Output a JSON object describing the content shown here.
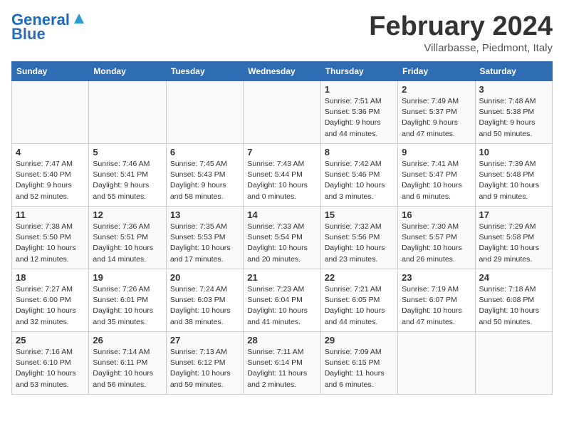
{
  "header": {
    "logo_line1": "General",
    "logo_line2": "Blue",
    "month": "February 2024",
    "location": "Villarbasse, Piedmont, Italy"
  },
  "days_of_week": [
    "Sunday",
    "Monday",
    "Tuesday",
    "Wednesday",
    "Thursday",
    "Friday",
    "Saturday"
  ],
  "weeks": [
    [
      {
        "day": "",
        "info": ""
      },
      {
        "day": "",
        "info": ""
      },
      {
        "day": "",
        "info": ""
      },
      {
        "day": "",
        "info": ""
      },
      {
        "day": "1",
        "info": "Sunrise: 7:51 AM\nSunset: 5:36 PM\nDaylight: 9 hours\nand 44 minutes."
      },
      {
        "day": "2",
        "info": "Sunrise: 7:49 AM\nSunset: 5:37 PM\nDaylight: 9 hours\nand 47 minutes."
      },
      {
        "day": "3",
        "info": "Sunrise: 7:48 AM\nSunset: 5:38 PM\nDaylight: 9 hours\nand 50 minutes."
      }
    ],
    [
      {
        "day": "4",
        "info": "Sunrise: 7:47 AM\nSunset: 5:40 PM\nDaylight: 9 hours\nand 52 minutes."
      },
      {
        "day": "5",
        "info": "Sunrise: 7:46 AM\nSunset: 5:41 PM\nDaylight: 9 hours\nand 55 minutes."
      },
      {
        "day": "6",
        "info": "Sunrise: 7:45 AM\nSunset: 5:43 PM\nDaylight: 9 hours\nand 58 minutes."
      },
      {
        "day": "7",
        "info": "Sunrise: 7:43 AM\nSunset: 5:44 PM\nDaylight: 10 hours\nand 0 minutes."
      },
      {
        "day": "8",
        "info": "Sunrise: 7:42 AM\nSunset: 5:46 PM\nDaylight: 10 hours\nand 3 minutes."
      },
      {
        "day": "9",
        "info": "Sunrise: 7:41 AM\nSunset: 5:47 PM\nDaylight: 10 hours\nand 6 minutes."
      },
      {
        "day": "10",
        "info": "Sunrise: 7:39 AM\nSunset: 5:48 PM\nDaylight: 10 hours\nand 9 minutes."
      }
    ],
    [
      {
        "day": "11",
        "info": "Sunrise: 7:38 AM\nSunset: 5:50 PM\nDaylight: 10 hours\nand 12 minutes."
      },
      {
        "day": "12",
        "info": "Sunrise: 7:36 AM\nSunset: 5:51 PM\nDaylight: 10 hours\nand 14 minutes."
      },
      {
        "day": "13",
        "info": "Sunrise: 7:35 AM\nSunset: 5:53 PM\nDaylight: 10 hours\nand 17 minutes."
      },
      {
        "day": "14",
        "info": "Sunrise: 7:33 AM\nSunset: 5:54 PM\nDaylight: 10 hours\nand 20 minutes."
      },
      {
        "day": "15",
        "info": "Sunrise: 7:32 AM\nSunset: 5:56 PM\nDaylight: 10 hours\nand 23 minutes."
      },
      {
        "day": "16",
        "info": "Sunrise: 7:30 AM\nSunset: 5:57 PM\nDaylight: 10 hours\nand 26 minutes."
      },
      {
        "day": "17",
        "info": "Sunrise: 7:29 AM\nSunset: 5:58 PM\nDaylight: 10 hours\nand 29 minutes."
      }
    ],
    [
      {
        "day": "18",
        "info": "Sunrise: 7:27 AM\nSunset: 6:00 PM\nDaylight: 10 hours\nand 32 minutes."
      },
      {
        "day": "19",
        "info": "Sunrise: 7:26 AM\nSunset: 6:01 PM\nDaylight: 10 hours\nand 35 minutes."
      },
      {
        "day": "20",
        "info": "Sunrise: 7:24 AM\nSunset: 6:03 PM\nDaylight: 10 hours\nand 38 minutes."
      },
      {
        "day": "21",
        "info": "Sunrise: 7:23 AM\nSunset: 6:04 PM\nDaylight: 10 hours\nand 41 minutes."
      },
      {
        "day": "22",
        "info": "Sunrise: 7:21 AM\nSunset: 6:05 PM\nDaylight: 10 hours\nand 44 minutes."
      },
      {
        "day": "23",
        "info": "Sunrise: 7:19 AM\nSunset: 6:07 PM\nDaylight: 10 hours\nand 47 minutes."
      },
      {
        "day": "24",
        "info": "Sunrise: 7:18 AM\nSunset: 6:08 PM\nDaylight: 10 hours\nand 50 minutes."
      }
    ],
    [
      {
        "day": "25",
        "info": "Sunrise: 7:16 AM\nSunset: 6:10 PM\nDaylight: 10 hours\nand 53 minutes."
      },
      {
        "day": "26",
        "info": "Sunrise: 7:14 AM\nSunset: 6:11 PM\nDaylight: 10 hours\nand 56 minutes."
      },
      {
        "day": "27",
        "info": "Sunrise: 7:13 AM\nSunset: 6:12 PM\nDaylight: 10 hours\nand 59 minutes."
      },
      {
        "day": "28",
        "info": "Sunrise: 7:11 AM\nSunset: 6:14 PM\nDaylight: 11 hours\nand 2 minutes."
      },
      {
        "day": "29",
        "info": "Sunrise: 7:09 AM\nSunset: 6:15 PM\nDaylight: 11 hours\nand 6 minutes."
      },
      {
        "day": "",
        "info": ""
      },
      {
        "day": "",
        "info": ""
      }
    ]
  ]
}
